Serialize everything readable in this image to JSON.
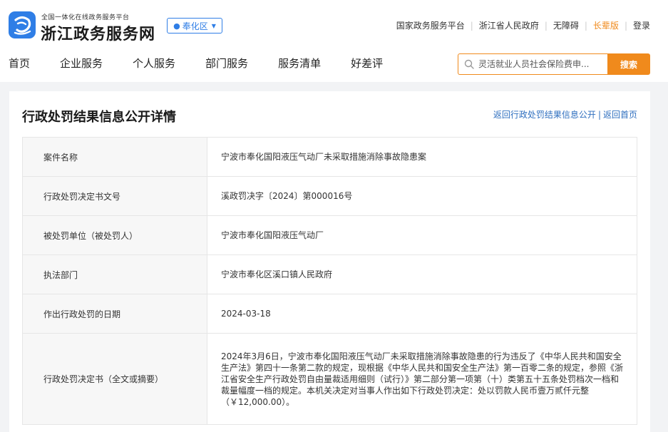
{
  "header": {
    "logo_subtitle": "全国一体化在线政务服务平台",
    "logo_title": "浙江政务服务网",
    "region": "奉化区",
    "top_links": [
      {
        "label": "国家政务服务平台"
      },
      {
        "label": "浙江省人民政府"
      },
      {
        "label": "无障碍"
      },
      {
        "label": "长辈版"
      },
      {
        "label": "登录"
      }
    ],
    "nav": [
      {
        "label": "首页"
      },
      {
        "label": "企业服务"
      },
      {
        "label": "个人服务"
      },
      {
        "label": "部门服务"
      },
      {
        "label": "服务清单"
      },
      {
        "label": "好差评"
      }
    ],
    "search": {
      "placeholder": "灵活就业人员社会保险费申...",
      "button": "搜索"
    },
    "colors": {
      "brand_blue": "#2f7ee6",
      "accent_orange": "#f08a1c"
    }
  },
  "main": {
    "title": "行政处罚结果信息公开详情",
    "links": [
      {
        "label": "返回行政处罚结果信息公开"
      },
      {
        "label": "返回首页"
      }
    ],
    "rows": [
      {
        "label": "案件名称",
        "value": "宁波市奉化国阳液压气动厂未采取措施消除事故隐患案"
      },
      {
        "label": "行政处罚决定书文号",
        "value": "溪政罚决字〔2024〕第000016号"
      },
      {
        "label": "被处罚单位（被处罚人）",
        "value": "宁波市奉化国阳液压气动厂"
      },
      {
        "label": "执法部门",
        "value": "宁波市奉化区溪口镇人民政府"
      },
      {
        "label": "作出行政处罚的日期",
        "value": "2024-03-18"
      },
      {
        "label": "行政处罚决定书（全文或摘要）",
        "value": "2024年3月6日，宁波市奉化国阳液压气动厂未采取措施消除事故隐患的行为违反了《中华人民共和国安全生产法》第四十一条第二款的规定，现根据《中华人民共和国安全生产法》第一百零二条的规定，参照《浙江省安全生产行政处罚自由量裁适用细则（试行）》第二部分第一项第（十）类第五十五条处罚档次一档和裁量幅度一档的规定。本机关决定对当事人作出如下行政处罚决定：处以罚款人民币壹万贰仟元整（￥12,000.00）。"
      }
    ]
  }
}
